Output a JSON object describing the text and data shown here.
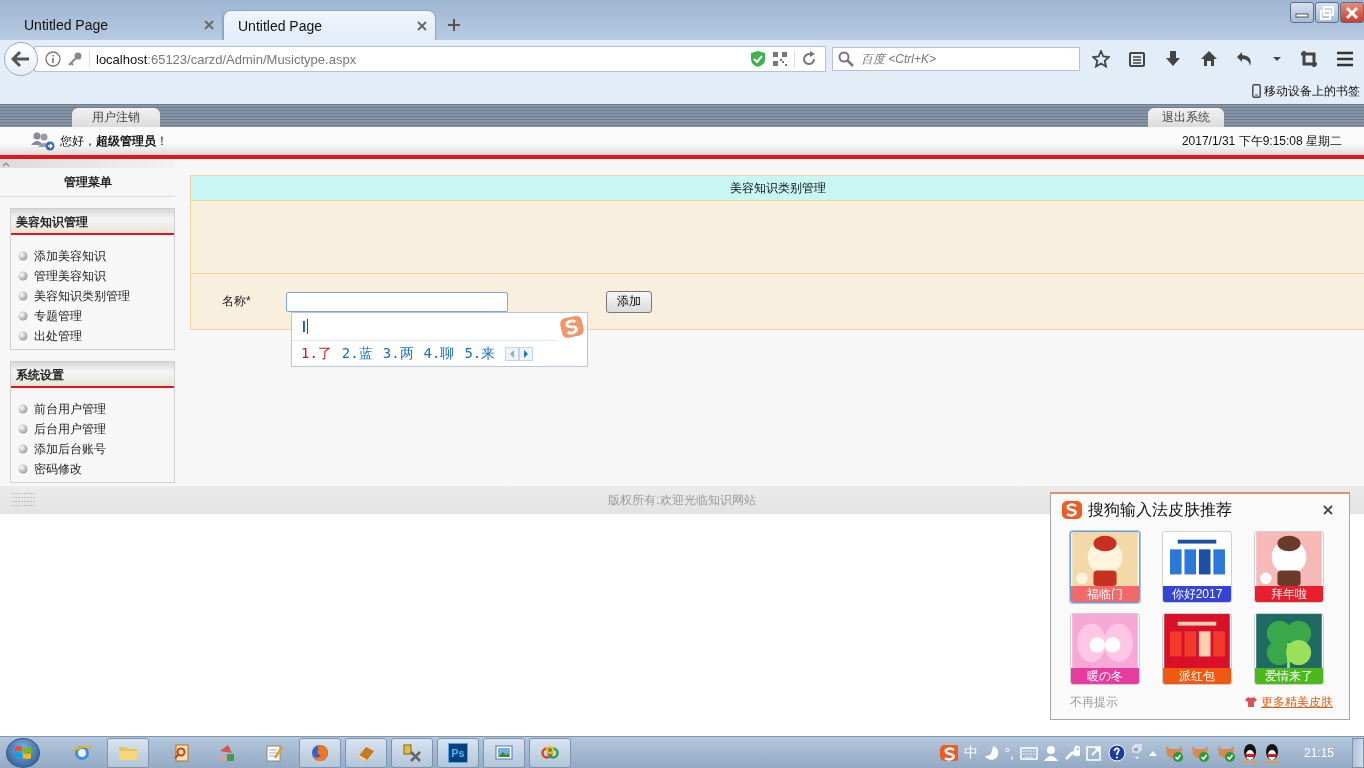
{
  "browser": {
    "tabs": [
      {
        "title": "Untitled Page",
        "selected": false
      },
      {
        "title": "Untitled Page",
        "selected": true
      }
    ],
    "url": {
      "host": "localhost",
      "rest": ":65123/carzd/Admin/Musictype.aspx"
    },
    "search": {
      "placeholder": "百度 <Ctrl+K>"
    },
    "bookmarks": [
      "移动设备上的书签"
    ]
  },
  "header": {
    "tabs": [
      "用户注销",
      "退出系统"
    ],
    "greeting": "您好，**超级管理员**！",
    "datetime": "2017/1/31 下午9:15:08 星期二"
  },
  "sidebar": {
    "title": "管理菜单",
    "groups": [
      {
        "title": "美容知识管理",
        "items": [
          "添加美容知识",
          "管理美容知识",
          "美容知识类别管理",
          "专题管理",
          "出处管理"
        ]
      },
      {
        "title": "系统设置",
        "items": [
          "前台用户管理",
          "后台用户管理",
          "添加后台账号",
          "密码修改"
        ]
      }
    ]
  },
  "panel": {
    "title": "美容知识类别管理",
    "field_label": "名称*",
    "button": "添加"
  },
  "ime": {
    "composition": "l",
    "candidates": [
      {
        "text": "1.了",
        "selected": true
      },
      {
        "text": "2.蓝",
        "selected": false
      },
      {
        "text": "3.两",
        "selected": false
      },
      {
        "text": "4.聊",
        "selected": false
      },
      {
        "text": "5.来",
        "selected": false
      }
    ]
  },
  "footer": "版权所有:欢迎光临知识网站",
  "skin_popup": {
    "title": "搜狗输入法皮肤推荐",
    "skins": [
      {
        "label": "福临门",
        "color": "#f06a6a",
        "selected": true
      },
      {
        "label": "你好2017",
        "color": "#3443d8",
        "selected": false
      },
      {
        "label": "拜年啦",
        "color": "#e8202e",
        "selected": false
      },
      {
        "label": "暖の冬",
        "color": "#e63ca0",
        "selected": false
      },
      {
        "label": "派红包",
        "color": "#f05a10",
        "selected": false
      },
      {
        "label": "爱情来了",
        "color": "#4cb81e",
        "selected": false
      }
    ],
    "dismiss": "不再提示",
    "more": "更多精美皮肤"
  },
  "taskbar": {
    "apps": [
      {
        "running": false
      },
      {
        "running": true
      },
      {
        "running": false
      },
      {
        "running": false
      },
      {
        "running": false
      },
      {
        "running": true
      },
      {
        "running": true
      },
      {
        "running": true
      },
      {
        "running": true,
        "label": "Ps"
      },
      {
        "running": true
      },
      {
        "running": true
      }
    ],
    "tray": {
      "ime_mode": "中",
      "punctuation": "°,"
    },
    "clock": "21:15"
  }
}
